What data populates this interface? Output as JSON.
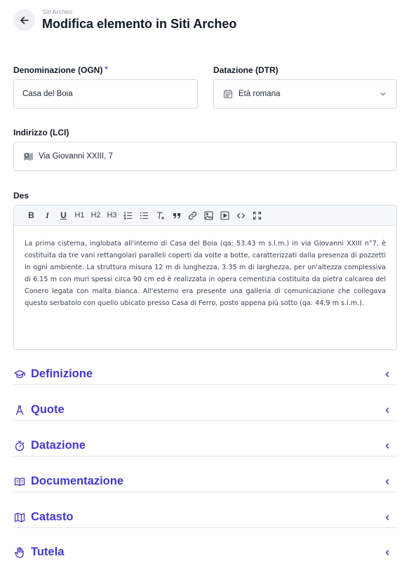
{
  "header": {
    "breadcrumb": "Siti Archeo",
    "title": "Modifica elemento in Siti Archeo"
  },
  "form": {
    "denominazione": {
      "label": "Denominazione (OGN)",
      "required_mark": "*",
      "value": "Casa del Boia"
    },
    "datazione": {
      "label": "Datazione (DTR)",
      "value": "Età romana"
    },
    "indirizzo": {
      "label": "Indirizzo (LCI)",
      "value": "Via Giovanni XXIII, 7"
    },
    "descrizione": {
      "label": "Des",
      "toolbar": {
        "bold": "B",
        "italic": "I",
        "underline": "U",
        "h1": "H1",
        "h2": "H2",
        "h3": "H3"
      },
      "content": "La prima cisterna, inglobata all'interno di Casa del Boia  (qa: 53.43 m s.l.m.) in via Giovanni XXIII n°7, è costituita da tre vani rettangolari paralleli coperti da volte a botte, caratterizzati dalla presenza di pozzetti in ogni ambiente. La struttura misura 12 m di lunghezza, 3.35 m di larghezza, per un'altezza complessiva di 6.15 m con muri spessi circa 90 cm ed è realizzata in opera cementizia costituita da pietra calcarea del Conero legata con malta bianca. All'esterno era presente una galleria di comunicazione che collegava questo serbatoio con quello ubicato presso Casa di Ferro, posto appena più sotto (qa: 44.9 m s.l.m.)."
    }
  },
  "sections": [
    {
      "title": "Definizione",
      "icon": "graduation-cap-icon"
    },
    {
      "title": "Quote",
      "icon": "compass-icon"
    },
    {
      "title": "Datazione",
      "icon": "stopwatch-icon"
    },
    {
      "title": "Documentazione",
      "icon": "open-book-icon"
    },
    {
      "title": "Catasto",
      "icon": "map-icon"
    },
    {
      "title": "Tutela",
      "icon": "hand-icon"
    }
  ],
  "colors": {
    "accent": "#4338ca",
    "border": "#d8dbe1",
    "toolbar_bg": "#f5f8fb"
  }
}
